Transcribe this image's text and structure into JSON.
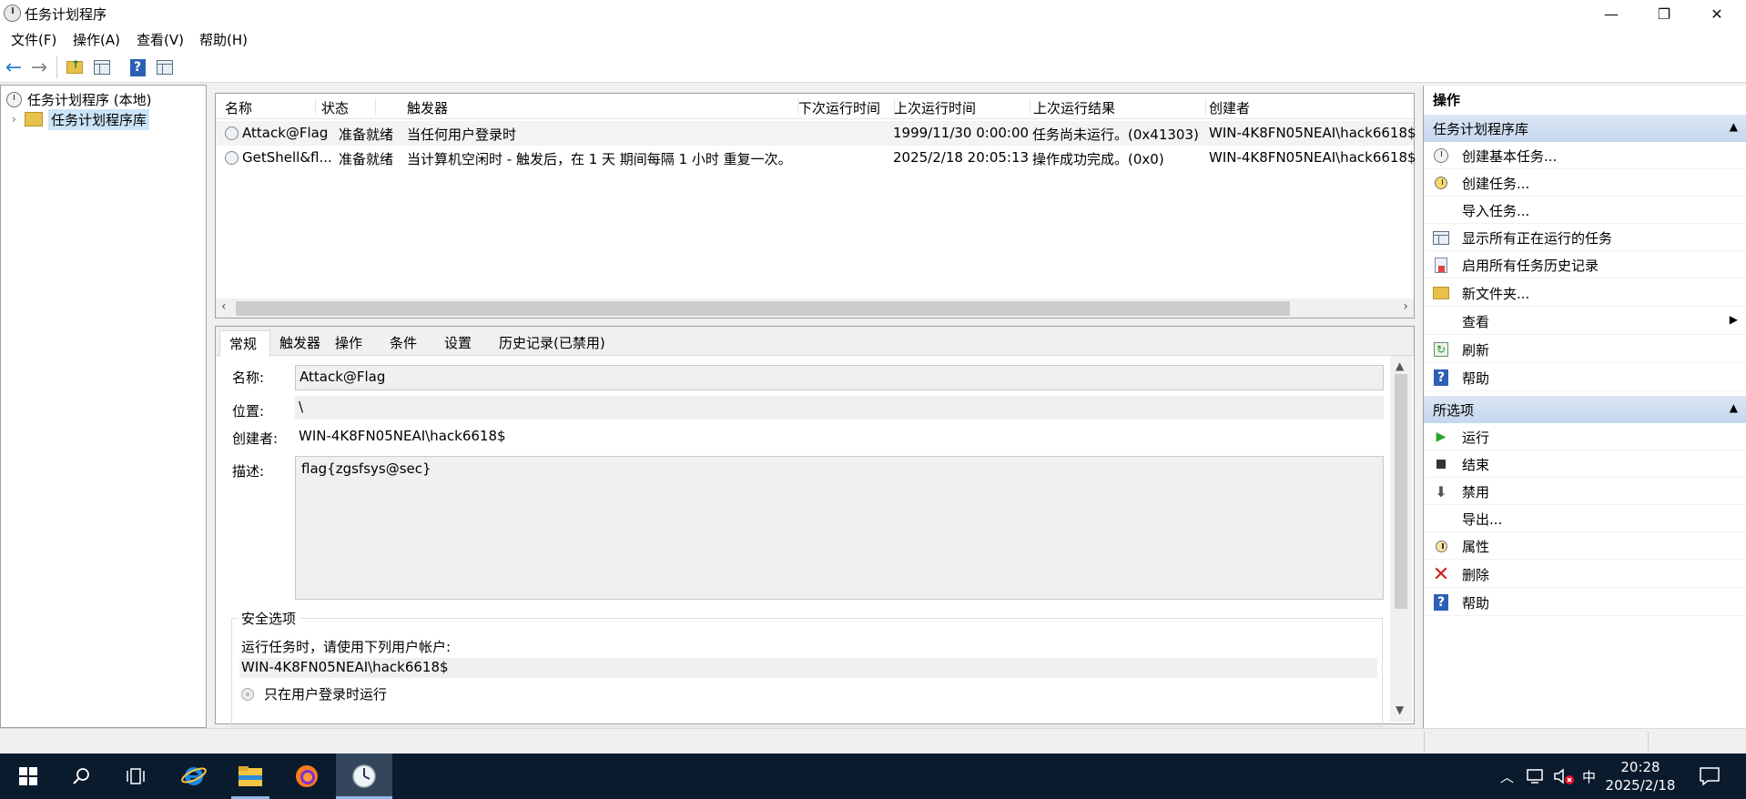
{
  "window": {
    "title": "任务计划程序",
    "minimize": "—",
    "maximize": "❐",
    "close": "✕"
  },
  "menu": [
    "文件(F)",
    "操作(A)",
    "查看(V)",
    "帮助(H)"
  ],
  "toolbar": {
    "back_icon": "←",
    "forward_icon": "→",
    "help_icon": "?"
  },
  "tree": {
    "root": "任务计划程序 (本地)",
    "library": "任务计划程序库"
  },
  "task_list": {
    "columns": [
      "名称",
      "状态",
      "触发器",
      "下次运行时间",
      "上次运行时间",
      "上次运行结果",
      "创建者"
    ],
    "rows": [
      {
        "name": "Attack@Flag",
        "status": "准备就绪",
        "trigger": "当任何用户登录时",
        "next_run": "",
        "last_run": "1999/11/30 0:00:00",
        "last_result": "任务尚未运行。(0x41303)",
        "author": "WIN-4K8FN05NEAI\\hack6618$"
      },
      {
        "name": "GetShell&fl...",
        "status": "准备就绪",
        "trigger": "当计算机空闲时 - 触发后，在 1 天 期间每隔 1 小时 重复一次。",
        "next_run": "",
        "last_run": "2025/2/18 20:05:13",
        "last_result": "操作成功完成。(0x0)",
        "author": "WIN-4K8FN05NEAI\\hack6618$"
      }
    ]
  },
  "details": {
    "tabs": [
      "常规",
      "触发器",
      "操作",
      "条件",
      "设置",
      "历史记录(已禁用)"
    ],
    "name_label": "名称:",
    "name_value": "Attack@Flag",
    "location_label": "位置:",
    "location_value": "\\",
    "author_label": "创建者:",
    "author_value": "WIN-4K8FN05NEAI\\hack6618$",
    "description_label": "描述:",
    "description_value": "flag{zgsfsys@sec}",
    "security": {
      "legend": "安全选项",
      "run_as_label": "运行任务时，请使用下列用户帐户:",
      "run_as_value": "WIN-4K8FN05NEAI\\hack6618$",
      "option_logged_on": "只在用户登录时运行"
    }
  },
  "actions": {
    "title": "操作",
    "section1": {
      "header": "任务计划程序库",
      "items": [
        {
          "label": "创建基本任务...",
          "icon": "create-basic-task-icon"
        },
        {
          "label": "创建任务...",
          "icon": "create-task-icon"
        },
        {
          "label": "导入任务...",
          "icon": ""
        },
        {
          "label": "显示所有正在运行的任务",
          "icon": "running-tasks-icon"
        },
        {
          "label": "启用所有任务历史记录",
          "icon": "history-icon"
        },
        {
          "label": "新文件夹...",
          "icon": "new-folder-icon"
        },
        {
          "label": "查看",
          "icon": ""
        },
        {
          "label": "刷新",
          "icon": "refresh-icon"
        },
        {
          "label": "帮助",
          "icon": "help-icon"
        }
      ]
    },
    "section2": {
      "header": "所选项",
      "items": [
        {
          "label": "运行",
          "icon": "run-icon"
        },
        {
          "label": "结束",
          "icon": "stop-icon"
        },
        {
          "label": "禁用",
          "icon": "disable-icon"
        },
        {
          "label": "导出...",
          "icon": ""
        },
        {
          "label": "属性",
          "icon": "properties-icon"
        },
        {
          "label": "删除",
          "icon": "delete-icon"
        },
        {
          "label": "帮助",
          "icon": "help-icon"
        }
      ]
    }
  },
  "taskbar": {
    "ime": "中",
    "time": "20:28",
    "date": "2025/2/18"
  },
  "colors": {
    "section_header": "#c5d7ee",
    "taskbar": "#0b1b2e",
    "selection": "#cce4f7",
    "run_green": "#2aa52a",
    "delete_red": "#d42020",
    "help_blue": "#2d5fb5"
  }
}
